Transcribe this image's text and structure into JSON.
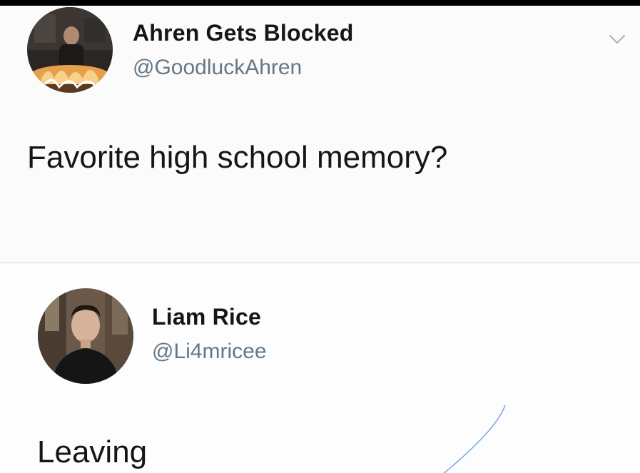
{
  "tweets": [
    {
      "display_name": "Ahren Gets Blocked",
      "handle": "@GoodluckAhren",
      "text": "Favorite high school memory?",
      "avatar": "profile-photo-person-by-fire"
    },
    {
      "display_name": "Liam Rice",
      "handle": "@Li4mricee",
      "text": "Leaving",
      "avatar": "profile-photo-young-man"
    }
  ],
  "icons": {
    "menu": "chevron-down-icon"
  },
  "colors": {
    "primary_text": "#14171a",
    "secondary_text": "#657786",
    "divider": "#e8ebee",
    "background": "#fbfbfc"
  }
}
